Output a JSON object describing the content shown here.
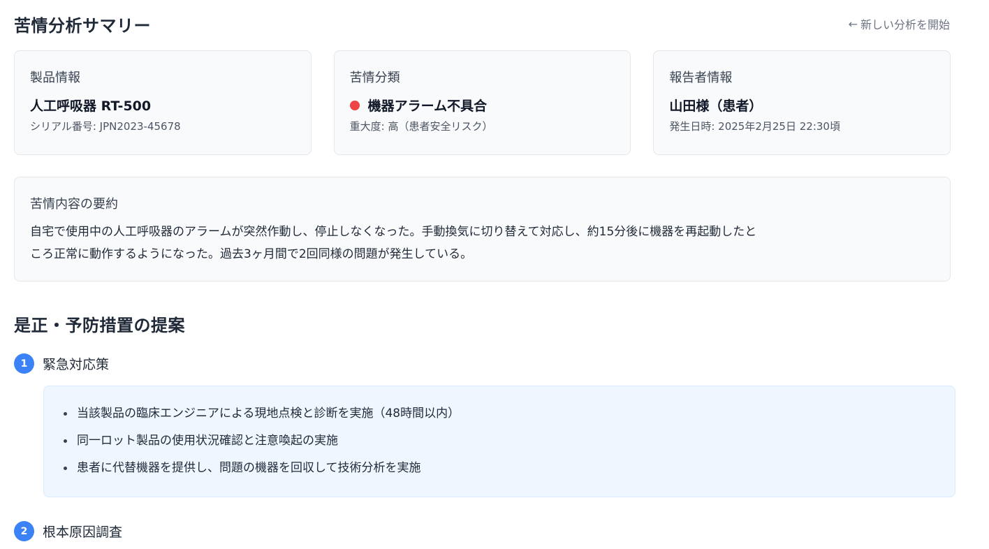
{
  "header": {
    "title": "苦情分析サマリー",
    "back_link": "新しい分析を開始",
    "back_icon": "←"
  },
  "cards": [
    {
      "label": "製品情報",
      "value": "人工呼吸器 RT-500",
      "sub": "シリアル番号: JPN2023-45678"
    },
    {
      "label": "苦情分類",
      "value": "機器アラーム不具合",
      "sub": "重大度: 高（患者安全リスク）",
      "indicator_color": "#ef4444"
    },
    {
      "label": "報告者情報",
      "value": "山田様（患者）",
      "sub": "発生日時: 2025年2月25日 22:30頃"
    }
  ],
  "summary": {
    "label": "苦情内容の要約",
    "text_line1": "自宅で使用中の人工呼吸器のアラームが突然作動し、停止しなくなった。手動換気に切り替えて対応し、約15分後に機器を再起動したと",
    "text_line2": "ころ正常に動作するようになった。過去3ヶ月間で2回同様の問題が発生している。"
  },
  "measures": {
    "title": "是正・予防措置の提案",
    "steps": [
      {
        "number": "1",
        "label": "緊急対応策",
        "items": [
          "当該製品の臨床エンジニアによる現地点検と診断を実施（48時間以内）",
          "同一ロット製品の使用状況確認と注意喚起の実施",
          "患者に代替機器を提供し、問題の機器を回収して技術分析を実施"
        ]
      },
      {
        "number": "2",
        "label": "根本原因調査"
      }
    ]
  },
  "colors": {
    "accent": "#3b82f6",
    "danger": "#ef4444",
    "card_bg": "#f9fafb",
    "action_bg": "#eff6ff"
  }
}
